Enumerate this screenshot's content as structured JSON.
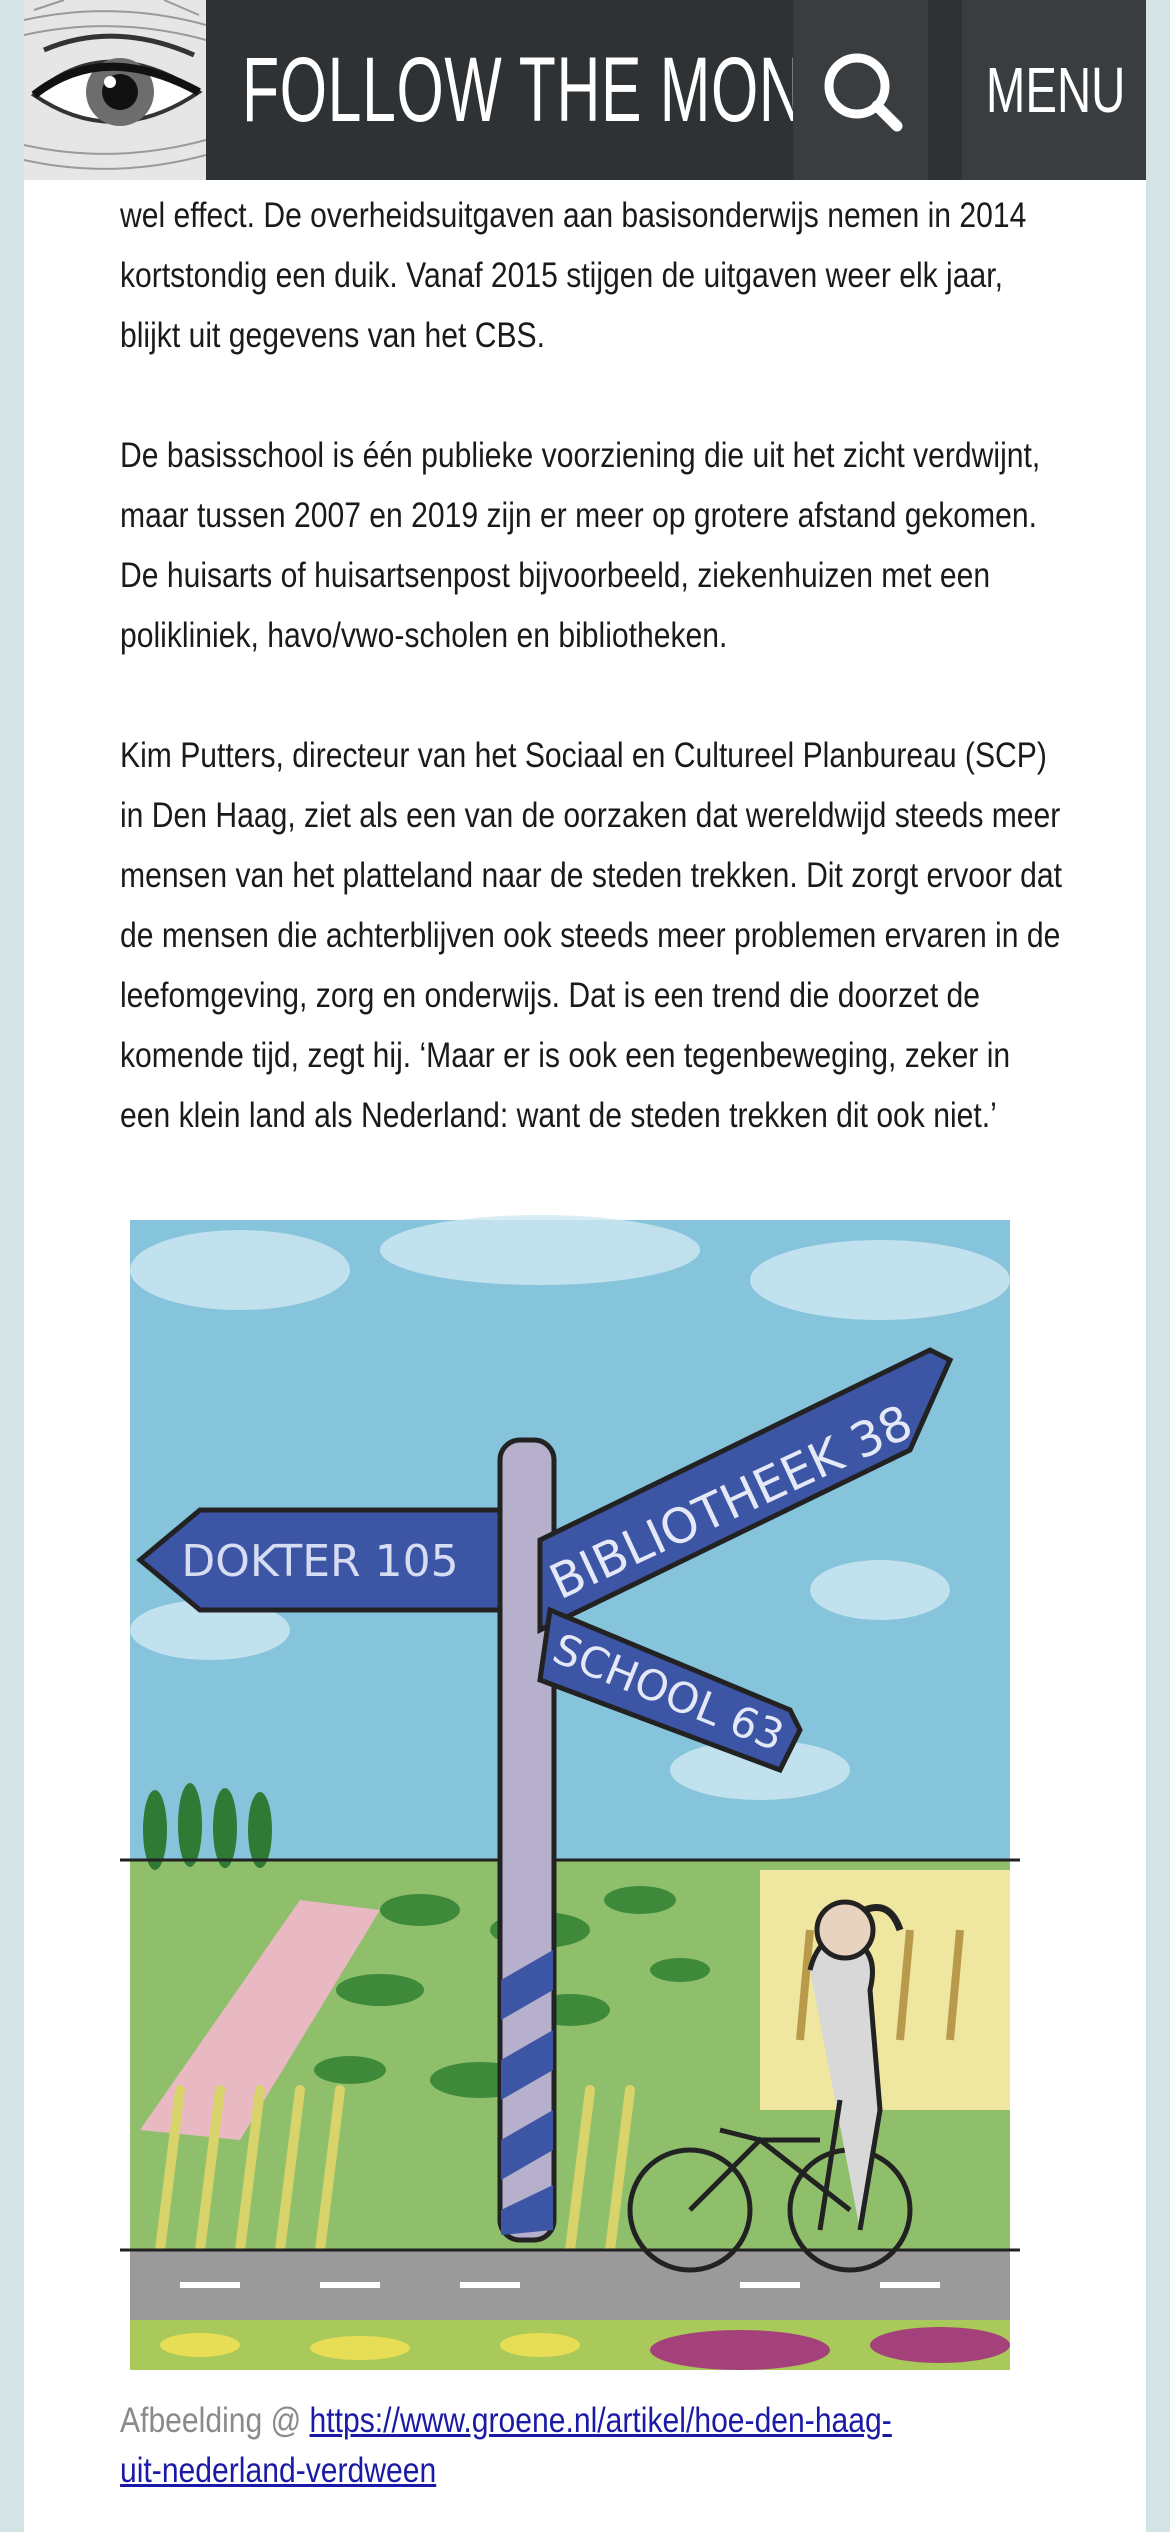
{
  "header": {
    "brand": "FOLLOW THE MONEY",
    "search_icon": "search-icon",
    "menu_label": "MENU",
    "colors": {
      "bar": "#2f3234",
      "buttons": "#3a3d3f"
    }
  },
  "article": {
    "paragraphs": [
      "wel effect. De overheidsuitgaven aan basisonderwijs nemen in 2014 kortstondig een duik. Vanaf 2015 stijgen de uitgaven weer elk jaar, blijkt uit gegevens van het CBS.",
      "De basisschool is één publieke voorziening die uit het zicht verdwijnt, maar tussen 2007 en 2019 zijn er meer op grotere afstand gekomen. De huisarts of huisartsenpost bijvoorbeeld, ziekenhuizen met een polikliniek, havo/vwo-scholen en bibliotheken.",
      "Kim Putters, directeur van het Sociaal en Cultureel Planbureau (SCP) in Den Haag, ziet als een van de oorzaken dat wereldwijd steeds meer mensen van het platteland naar de steden trekken. Dit zorgt ervoor dat de mensen die achterblijven ook steeds meer problemen ervaren in de leefomgeving, zorg en onderwijs. Dat is een trend die doorzet de komende tijd, zegt hij. ‘Maar er is ook een tegenbeweging, zeker in een klein land als Nederland: want de steden trekken dit ook niet.’"
    ]
  },
  "illustration": {
    "signs": [
      "DOKTER 105",
      "BIBLIOTHEEK 38",
      "SCHOOL 63"
    ]
  },
  "caption": {
    "prefix": "Afbeelding @ ",
    "link_text": "https://www.groene.nl/artikel/hoe-den-haag-uit-nederland-verdween"
  }
}
